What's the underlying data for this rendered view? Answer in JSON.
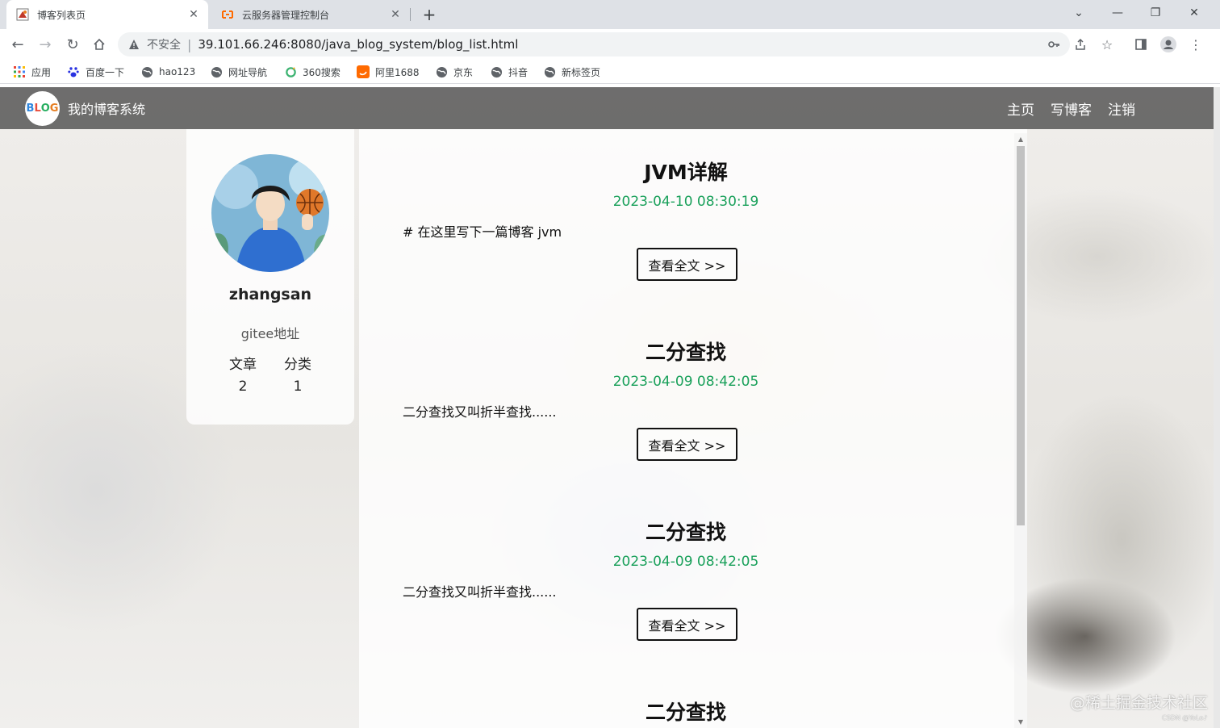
{
  "browser": {
    "tabs": [
      {
        "title": "博客列表页",
        "active": true
      },
      {
        "title": "云服务器管理控制台",
        "active": false
      }
    ],
    "address": {
      "security_label": "不安全",
      "url": "39.101.66.246:8080/java_blog_system/blog_list.html"
    },
    "bookmarks": [
      {
        "label": "应用",
        "icon": "apps-grid-icon"
      },
      {
        "label": "百度一下",
        "icon": "baidu-paw-icon"
      },
      {
        "label": "hao123",
        "icon": "globe-icon"
      },
      {
        "label": "网址导航",
        "icon": "globe-icon"
      },
      {
        "label": "360搜索",
        "icon": "search-360-icon"
      },
      {
        "label": "阿里1688",
        "icon": "alibaba-1688-icon"
      },
      {
        "label": "京东",
        "icon": "globe-icon"
      },
      {
        "label": "抖音",
        "icon": "globe-icon"
      },
      {
        "label": "新标签页",
        "icon": "globe-icon"
      }
    ]
  },
  "site": {
    "logo_text": "BLOG",
    "title": "我的博客系统",
    "nav": [
      "主页",
      "写博客",
      "注销"
    ]
  },
  "profile": {
    "username": "zhangsan",
    "gitee_link": "gitee地址",
    "stats_labels": [
      "文章",
      "分类"
    ],
    "stats_values": [
      "2",
      "1"
    ]
  },
  "posts": [
    {
      "title": "JVM详解",
      "date": "2023-04-10 08:30:19",
      "desc": "# 在这里写下一篇博客 jvm",
      "button": "查看全文 >>"
    },
    {
      "title": "二分查找",
      "date": "2023-04-09 08:42:05",
      "desc": "二分查找又叫折半查找......",
      "button": "查看全文 >>"
    },
    {
      "title": "二分查找",
      "date": "2023-04-09 08:42:05",
      "desc": "二分查找又叫折半查找......",
      "button": "查看全文 >>"
    },
    {
      "title": "二分查找"
    }
  ],
  "watermark": {
    "main": "@稀土掘金技术社区",
    "small": "CSDN @YoLo♪"
  },
  "colors": {
    "date_green": "#19a05a",
    "nav_bg": "#505050"
  }
}
